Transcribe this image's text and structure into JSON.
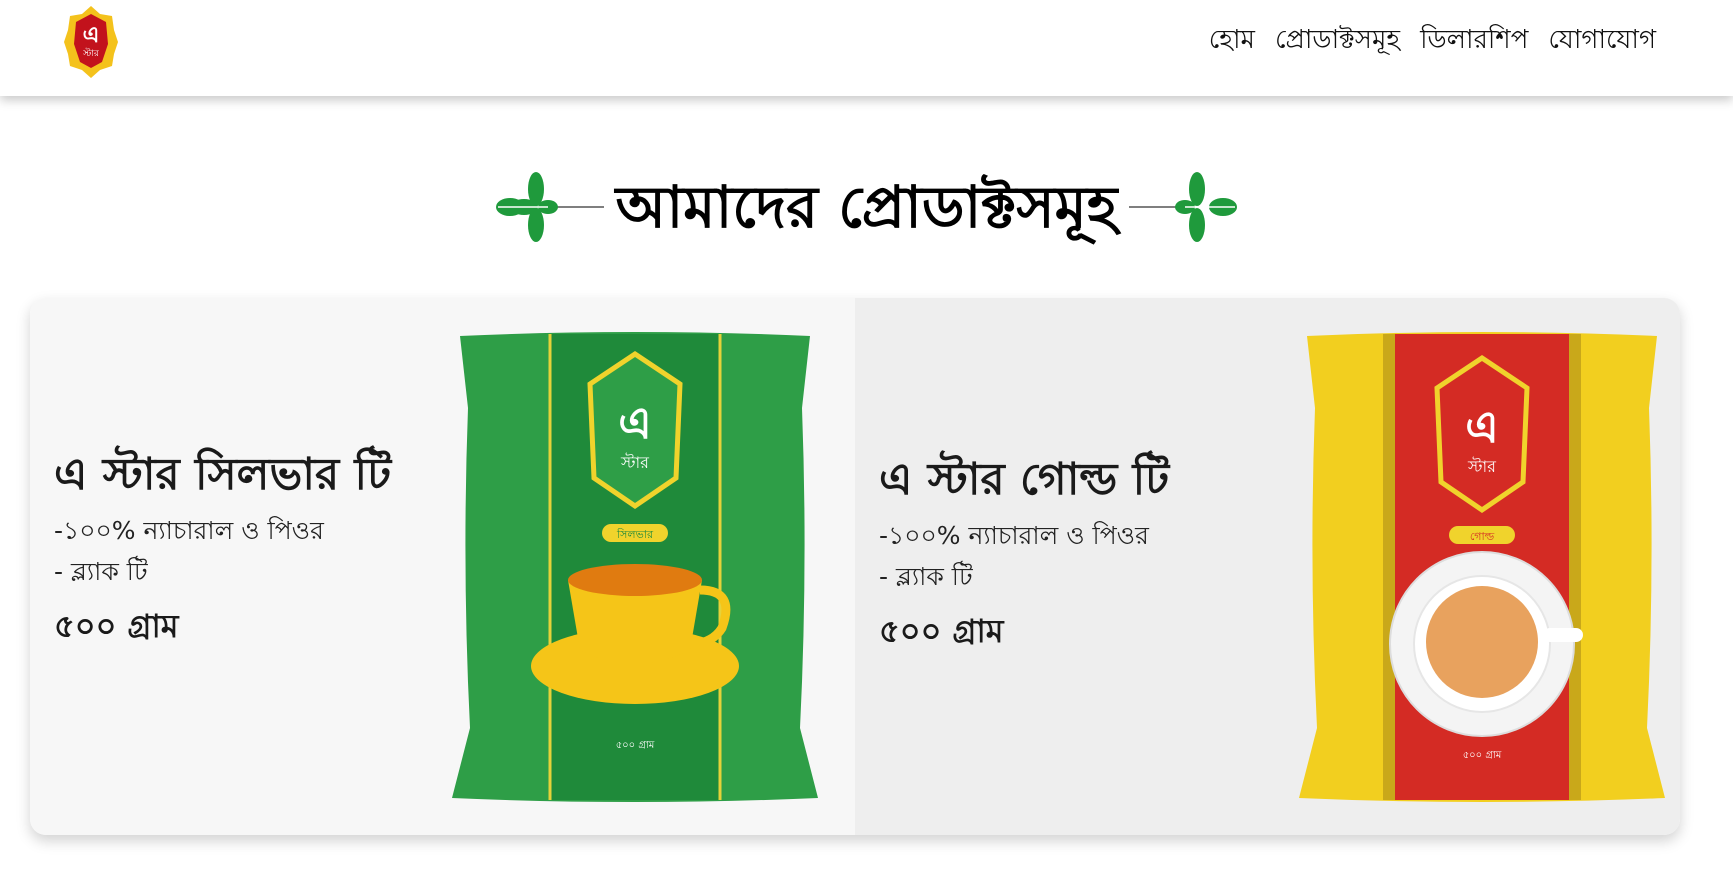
{
  "nav": {
    "items": [
      "হোম",
      "প্রোডাক্টসমূহ",
      "ডিলারশিপ",
      "যোগাযোগ"
    ]
  },
  "logo": {
    "text": "এ",
    "subtext": "স্টার"
  },
  "section": {
    "title": "আমাদের প্রোডাক্টসমূহ"
  },
  "products": [
    {
      "name": "এ স্টার সিলভার টি",
      "features": [
        "-১০০% ন্যাচারাল ও পিওর",
        "- ব্ল্যাক টি"
      ],
      "weight": "৫০০ গ্রাম",
      "pack": {
        "brand": "এ",
        "brand_sub": "স্টার",
        "label": "সিলভার",
        "net": "৫০০ গ্রাম",
        "color": "#2e9e47"
      }
    },
    {
      "name": "এ স্টার গোল্ড টি",
      "features": [
        "-১০০% ন্যাচারাল ও পিওর",
        "- ব্ল্যাক টি"
      ],
      "weight": "৫০০ গ্রাম",
      "pack": {
        "brand": "এ",
        "brand_sub": "স্টার",
        "label": "গোল্ড",
        "net": "৫০০ গ্রাম",
        "color": "#f2cf1f"
      }
    }
  ],
  "colors": {
    "leaf": "#1f9a3c",
    "header_bg": "#ffffff",
    "text": "#111111"
  }
}
